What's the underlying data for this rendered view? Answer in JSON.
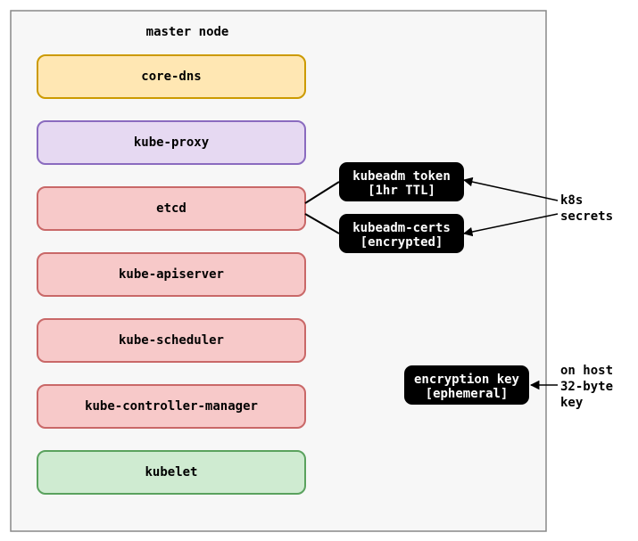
{
  "container": {
    "title": "master node"
  },
  "components": [
    {
      "id": "core-dns",
      "label": "core-dns",
      "fill": "#FFE7B3",
      "stroke": "#CC9A00"
    },
    {
      "id": "kube-proxy",
      "label": "kube-proxy",
      "fill": "#E6D9F2",
      "stroke": "#8A6BBF"
    },
    {
      "id": "etcd",
      "label": "etcd",
      "fill": "#F7C9C9",
      "stroke": "#C96868"
    },
    {
      "id": "kube-apiserver",
      "label": "kube-apiserver",
      "fill": "#F7C9C9",
      "stroke": "#C96868"
    },
    {
      "id": "kube-scheduler",
      "label": "kube-scheduler",
      "fill": "#F7C9C9",
      "stroke": "#C96868"
    },
    {
      "id": "kube-controller-manager",
      "label": "kube-controller-manager",
      "fill": "#F7C9C9",
      "stroke": "#C96868"
    },
    {
      "id": "kubelet",
      "label": "kubelet",
      "fill": "#CFEBD1",
      "stroke": "#5AA25E"
    }
  ],
  "badges": {
    "token": {
      "line1": "kubeadm token",
      "line2": "[1hr TTL]"
    },
    "certs": {
      "line1": "kubeadm-certs",
      "line2": "[encrypted]"
    },
    "enckey": {
      "line1": "encryption key",
      "line2": "[ephemeral]"
    }
  },
  "annotations": {
    "secrets": {
      "line1": "k8s",
      "line2": "secrets"
    },
    "enckey": {
      "line1": "on host",
      "line2": "32-byte",
      "line3": "key"
    }
  }
}
